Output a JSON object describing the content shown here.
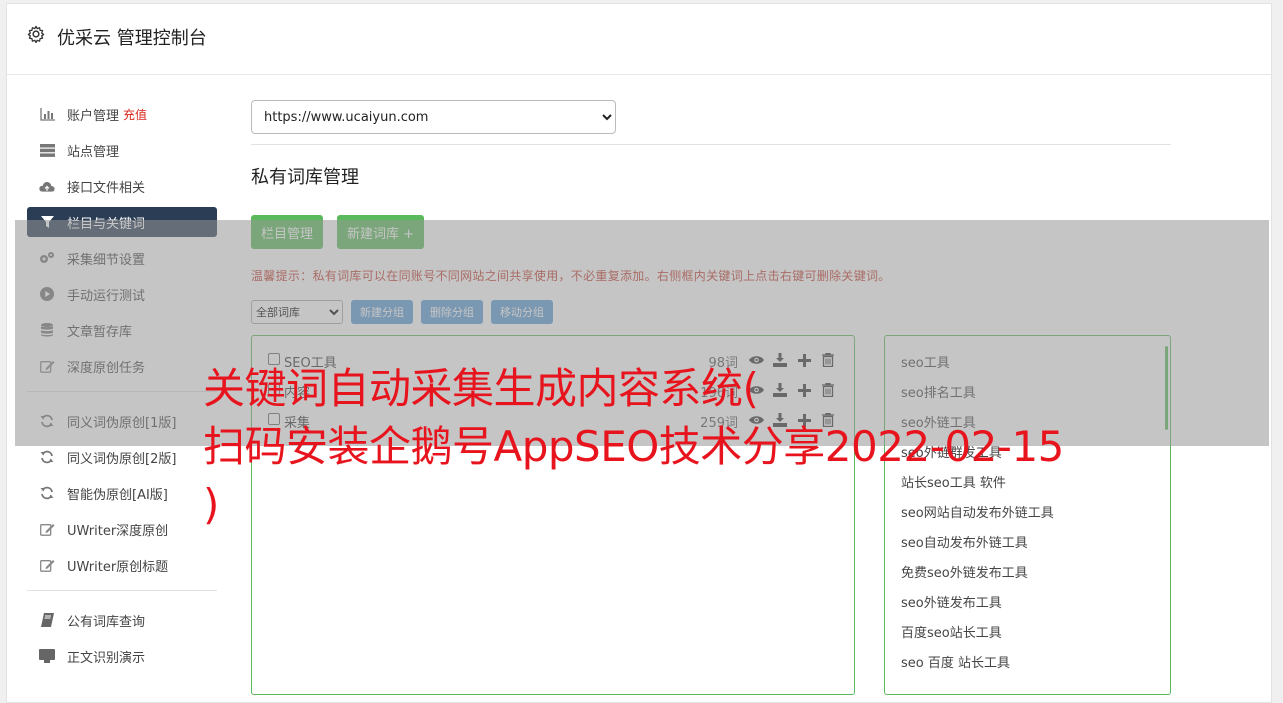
{
  "header": {
    "title": "优采云 管理控制台",
    "icon": "gear-icon"
  },
  "sidebar": {
    "group1": [
      {
        "label": "账户管理",
        "extra": "充值",
        "icon": "bar-chart-icon"
      },
      {
        "label": "站点管理",
        "icon": "server-icon"
      },
      {
        "label": "接口文件相关",
        "icon": "cloud-upload-icon"
      },
      {
        "label": "栏目与关键词",
        "icon": "filter-icon",
        "active": true
      },
      {
        "label": "采集细节设置",
        "icon": "gears-icon"
      },
      {
        "label": "手动运行测试",
        "icon": "play-circle-icon"
      },
      {
        "label": "文章暂存库",
        "icon": "database-icon"
      },
      {
        "label": "深度原创任务",
        "icon": "edit-icon"
      }
    ],
    "group2": [
      {
        "label": "同义词伪原创[1版]",
        "icon": "refresh-icon"
      },
      {
        "label": "同义词伪原创[2版]",
        "icon": "refresh-icon"
      },
      {
        "label": "智能伪原创[AI版]",
        "icon": "refresh-icon"
      },
      {
        "label": "UWriter深度原创",
        "icon": "edit-icon"
      },
      {
        "label": "UWriter原创标题",
        "icon": "edit-icon"
      }
    ],
    "group3": [
      {
        "label": "公有词库查询",
        "icon": "book-icon"
      },
      {
        "label": "正文识别演示",
        "icon": "monitor-icon"
      }
    ]
  },
  "main": {
    "site_select": "https://www.ucaiyun.com",
    "section_title": "私有词库管理",
    "btn_columns": "栏目管理",
    "btn_new_lib": "新建词库 +",
    "tip": "温馨提示：私有词库可以在同账号不同网站之间共享使用，不必重复添加。右侧框内关键词上点击右键可删除关键词。",
    "lib_filter": "全部词库",
    "btn_new_group": "新建分组",
    "btn_del_group": "删除分组",
    "btn_move_group": "移动分组",
    "libraries": [
      {
        "name": "SEO工具",
        "count": "98词"
      },
      {
        "name": "内容",
        "count": "196词"
      },
      {
        "name": "采集",
        "count": "259词"
      }
    ],
    "keywords": [
      "seo工具",
      "seo排名工具",
      "seo外链工具",
      "seo外链群发工具",
      "站长seo工具 软件",
      "seo网站自动发布外链工具",
      "seo自动发布外链工具",
      "免费seo外链发布工具",
      "seo外链发布工具",
      "百度seo站长工具",
      "seo 百度 站长工具"
    ]
  },
  "overlay_text": {
    "line1": "关键词自动采集生成内容系统(",
    "line2": "扫码安装企鹅号AppSEO技术分享2022-02-15",
    "line3": ")"
  }
}
